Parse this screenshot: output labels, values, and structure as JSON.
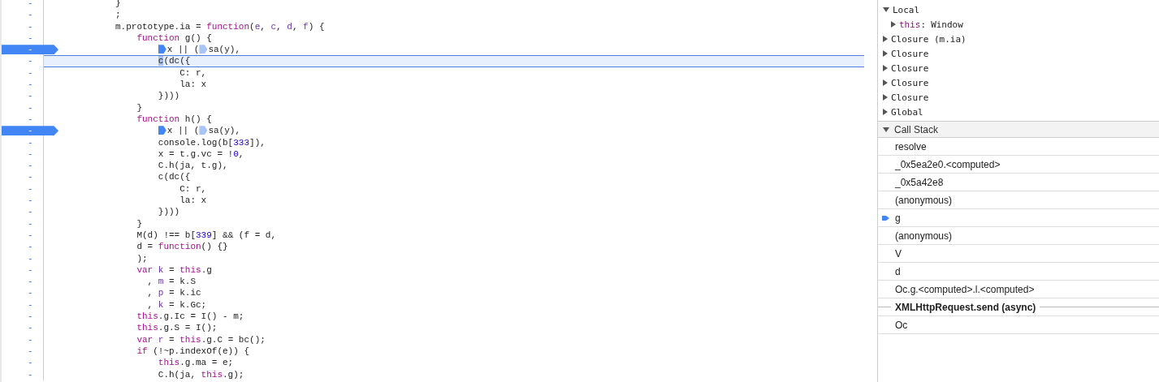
{
  "editor": {
    "lines": [
      {
        "gutter": "-",
        "breakpoint": false,
        "paused": false,
        "tokens": [
          {
            "t": "}",
            "kind": "plain"
          }
        ]
      },
      {
        "gutter": "-",
        "breakpoint": false,
        "paused": false,
        "tokens": [
          {
            "t": ";",
            "kind": "plain"
          }
        ]
      },
      {
        "gutter": "-",
        "breakpoint": false,
        "paused": false,
        "tokens": [
          {
            "t": "m.prototype.ia = ",
            "kind": "plain"
          },
          {
            "t": "function",
            "kind": "keyword"
          },
          {
            "t": "(",
            "kind": "plain"
          },
          {
            "t": "e",
            "kind": "def"
          },
          {
            "t": ", ",
            "kind": "plain"
          },
          {
            "t": "c",
            "kind": "def"
          },
          {
            "t": ", ",
            "kind": "plain"
          },
          {
            "t": "d",
            "kind": "def"
          },
          {
            "t": ", ",
            "kind": "plain"
          },
          {
            "t": "f",
            "kind": "def"
          },
          {
            "t": ") {",
            "kind": "plain"
          }
        ],
        "children": [
          {
            "gutter": "-",
            "breakpoint": false,
            "paused": false,
            "tokens": [
              {
                "t": "function",
                "kind": "keyword"
              },
              {
                "t": " g() {",
                "kind": "plain"
              }
            ],
            "children": [
              {
                "gutter": "-",
                "breakpoint": true,
                "paused": false,
                "tokens": [
                  {
                    "kind": "marker",
                    "active": true
                  },
                  {
                    "t": "x || (",
                    "kind": "plain"
                  },
                  {
                    "kind": "marker",
                    "active": false
                  },
                  {
                    "t": "sa(y),",
                    "kind": "plain"
                  }
                ]
              },
              {
                "gutter": "-",
                "breakpoint": false,
                "paused": true,
                "tokens": [
                  {
                    "t": "c",
                    "kind": "current"
                  },
                  {
                    "t": "(dc({",
                    "kind": "plain"
                  }
                ],
                "children": [
                  {
                    "gutter": "-",
                    "breakpoint": false,
                    "paused": false,
                    "tokens": [
                      {
                        "t": "C: r,",
                        "kind": "plain"
                      }
                    ]
                  },
                  {
                    "gutter": "-",
                    "breakpoint": false,
                    "paused": false,
                    "tokens": [
                      {
                        "t": "la: x",
                        "kind": "plain"
                      }
                    ]
                  }
                ]
              },
              {
                "gutter": "-",
                "breakpoint": false,
                "paused": false,
                "tokens": [
                  {
                    "t": "})))",
                    "kind": "plain"
                  }
                ]
              }
            ]
          },
          {
            "gutter": "-",
            "breakpoint": false,
            "paused": false,
            "tokens": [
              {
                "t": "}",
                "kind": "plain"
              }
            ]
          },
          {
            "gutter": "-",
            "breakpoint": false,
            "paused": false,
            "tokens": [
              {
                "t": "function",
                "kind": "keyword"
              },
              {
                "t": " h() {",
                "kind": "plain"
              }
            ],
            "children": [
              {
                "gutter": "-",
                "breakpoint": true,
                "paused": false,
                "tokens": [
                  {
                    "kind": "marker",
                    "active": true
                  },
                  {
                    "t": "x || (",
                    "kind": "plain"
                  },
                  {
                    "kind": "marker",
                    "active": false
                  },
                  {
                    "t": "sa(y),",
                    "kind": "plain"
                  }
                ]
              },
              {
                "gutter": "-",
                "breakpoint": false,
                "paused": false,
                "tokens": [
                  {
                    "t": "console.log(b[",
                    "kind": "plain"
                  },
                  {
                    "t": "333",
                    "kind": "number"
                  },
                  {
                    "t": "]),",
                    "kind": "plain"
                  }
                ]
              },
              {
                "gutter": "-",
                "breakpoint": false,
                "paused": false,
                "tokens": [
                  {
                    "t": "x = t.g.vc = !",
                    "kind": "plain"
                  },
                  {
                    "t": "0",
                    "kind": "number"
                  },
                  {
                    "t": ",",
                    "kind": "plain"
                  }
                ]
              },
              {
                "gutter": "-",
                "breakpoint": false,
                "paused": false,
                "tokens": [
                  {
                    "t": "C.h(ja, t.g),",
                    "kind": "plain"
                  }
                ]
              },
              {
                "gutter": "-",
                "breakpoint": false,
                "paused": false,
                "tokens": [
                  {
                    "t": "c(dc({",
                    "kind": "plain"
                  }
                ],
                "children": [
                  {
                    "gutter": "-",
                    "breakpoint": false,
                    "paused": false,
                    "tokens": [
                      {
                        "t": "C: r,",
                        "kind": "plain"
                      }
                    ]
                  },
                  {
                    "gutter": "-",
                    "breakpoint": false,
                    "paused": false,
                    "tokens": [
                      {
                        "t": "la: x",
                        "kind": "plain"
                      }
                    ]
                  }
                ]
              },
              {
                "gutter": "-",
                "breakpoint": false,
                "paused": false,
                "tokens": [
                  {
                    "t": "})))",
                    "kind": "plain"
                  }
                ]
              }
            ]
          },
          {
            "gutter": "-",
            "breakpoint": false,
            "paused": false,
            "tokens": [
              {
                "t": "}",
                "kind": "plain"
              }
            ]
          },
          {
            "gutter": "-",
            "breakpoint": false,
            "paused": false,
            "tokens": [
              {
                "t": "M(d) !== b[",
                "kind": "plain"
              },
              {
                "t": "339",
                "kind": "number"
              },
              {
                "t": "] && (f = d,",
                "kind": "plain"
              }
            ]
          },
          {
            "gutter": "-",
            "breakpoint": false,
            "paused": false,
            "tokens": [
              {
                "t": "d = ",
                "kind": "plain"
              },
              {
                "t": "function",
                "kind": "keyword"
              },
              {
                "t": "() {}",
                "kind": "plain"
              }
            ]
          },
          {
            "gutter": "-",
            "breakpoint": false,
            "paused": false,
            "tokens": [
              {
                "t": ");",
                "kind": "plain"
              }
            ]
          },
          {
            "gutter": "-",
            "breakpoint": false,
            "paused": false,
            "tokens": [
              {
                "t": "var",
                "kind": "keyword"
              },
              {
                "t": " k",
                "kind": "def"
              },
              {
                "t": " = ",
                "kind": "plain"
              },
              {
                "t": "this",
                "kind": "keyword"
              },
              {
                "t": ".g",
                "kind": "plain"
              }
            ]
          },
          {
            "gutter": "-",
            "breakpoint": false,
            "paused": false,
            "tokens": [
              {
                "t": "  , ",
                "kind": "plain"
              },
              {
                "t": "m",
                "kind": "def"
              },
              {
                "t": " = k.S",
                "kind": "plain"
              }
            ]
          },
          {
            "gutter": "-",
            "breakpoint": false,
            "paused": false,
            "tokens": [
              {
                "t": "  , ",
                "kind": "plain"
              },
              {
                "t": "p",
                "kind": "def"
              },
              {
                "t": " = k.ic",
                "kind": "plain"
              }
            ]
          },
          {
            "gutter": "-",
            "breakpoint": false,
            "paused": false,
            "tokens": [
              {
                "t": "  , ",
                "kind": "plain"
              },
              {
                "t": "k",
                "kind": "def"
              },
              {
                "t": " = k.Gc;",
                "kind": "plain"
              }
            ]
          },
          {
            "gutter": "-",
            "breakpoint": false,
            "paused": false,
            "tokens": [
              {
                "t": "this",
                "kind": "keyword"
              },
              {
                "t": ".g.Ic = I() - m;",
                "kind": "plain"
              }
            ]
          },
          {
            "gutter": "-",
            "breakpoint": false,
            "paused": false,
            "tokens": [
              {
                "t": "this",
                "kind": "keyword"
              },
              {
                "t": ".g.S = I();",
                "kind": "plain"
              }
            ]
          },
          {
            "gutter": "-",
            "breakpoint": false,
            "paused": false,
            "tokens": [
              {
                "t": "var",
                "kind": "keyword"
              },
              {
                "t": " r",
                "kind": "def"
              },
              {
                "t": " = ",
                "kind": "plain"
              },
              {
                "t": "this",
                "kind": "keyword"
              },
              {
                "t": ".g.C = bc();",
                "kind": "plain"
              }
            ]
          },
          {
            "gutter": "-",
            "breakpoint": false,
            "paused": false,
            "tokens": [
              {
                "t": "if",
                "kind": "keyword"
              },
              {
                "t": " (!~p.indexOf(e)) {",
                "kind": "plain"
              }
            ],
            "children": [
              {
                "gutter": "-",
                "breakpoint": false,
                "paused": false,
                "tokens": [
                  {
                    "t": "this",
                    "kind": "keyword"
                  },
                  {
                    "t": ".g.ma = e;",
                    "kind": "plain"
                  }
                ]
              },
              {
                "gutter": "-",
                "breakpoint": false,
                "paused": false,
                "tokens": [
                  {
                    "t": "C.h(ja, ",
                    "kind": "plain"
                  },
                  {
                    "t": "this",
                    "kind": "keyword"
                  },
                  {
                    "t": ".g);",
                    "kind": "plain"
                  }
                ]
              }
            ]
          }
        ]
      }
    ]
  },
  "scope": [
    {
      "label": "Local",
      "expanded": true,
      "children": [
        {
          "name": "this",
          "separator": ":",
          "value": "Window",
          "expanded": false
        }
      ]
    },
    {
      "label": "Closure (m.ia)",
      "expanded": false
    },
    {
      "label": "Closure",
      "expanded": false
    },
    {
      "label": "Closure",
      "expanded": false
    },
    {
      "label": "Closure",
      "expanded": false
    },
    {
      "label": "Closure",
      "expanded": false
    },
    {
      "label": "Global",
      "expanded": false
    }
  ],
  "call_stack": {
    "title": "Call Stack",
    "expanded": true,
    "frames": [
      {
        "kind": "frame",
        "name": "resolve",
        "current": false
      },
      {
        "kind": "frame",
        "name": "_0x5ea2e0.<computed>",
        "current": false
      },
      {
        "kind": "frame",
        "name": "_0x5a42e8",
        "current": false
      },
      {
        "kind": "frame",
        "name": "(anonymous)",
        "current": false
      },
      {
        "kind": "frame",
        "name": "g",
        "current": true
      },
      {
        "kind": "frame",
        "name": "(anonymous)",
        "current": false
      },
      {
        "kind": "frame",
        "name": "V",
        "current": false
      },
      {
        "kind": "frame",
        "name": "d",
        "current": false
      },
      {
        "kind": "frame",
        "name": "Oc.g.<computed>.l.<computed>",
        "current": false
      },
      {
        "kind": "async",
        "name": "XMLHttpRequest.send (async)"
      },
      {
        "kind": "frame",
        "name": "Oc",
        "current": false
      }
    ]
  }
}
